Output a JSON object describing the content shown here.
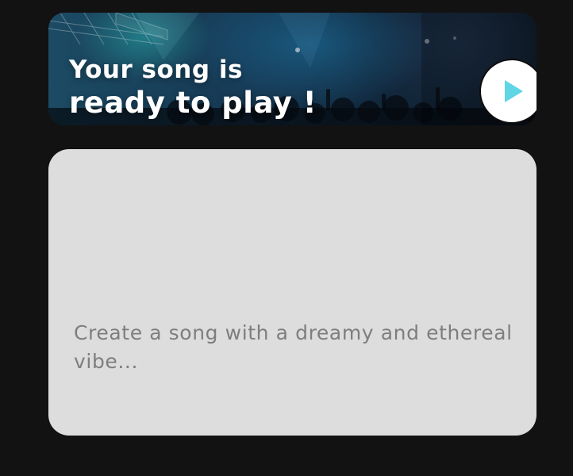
{
  "banner": {
    "line1": "Your song is",
    "line2": "ready to play !",
    "play_icon": "play-icon",
    "play_icon_color": "#5fd5e6"
  },
  "prompt": {
    "value": "",
    "placeholder": "Create a song with a dreamy and ethereal vibe..."
  },
  "colors": {
    "background": "#121212",
    "card": "#dddddd",
    "placeholder_text": "#7e7e7e",
    "banner_text": "#ffffff"
  }
}
